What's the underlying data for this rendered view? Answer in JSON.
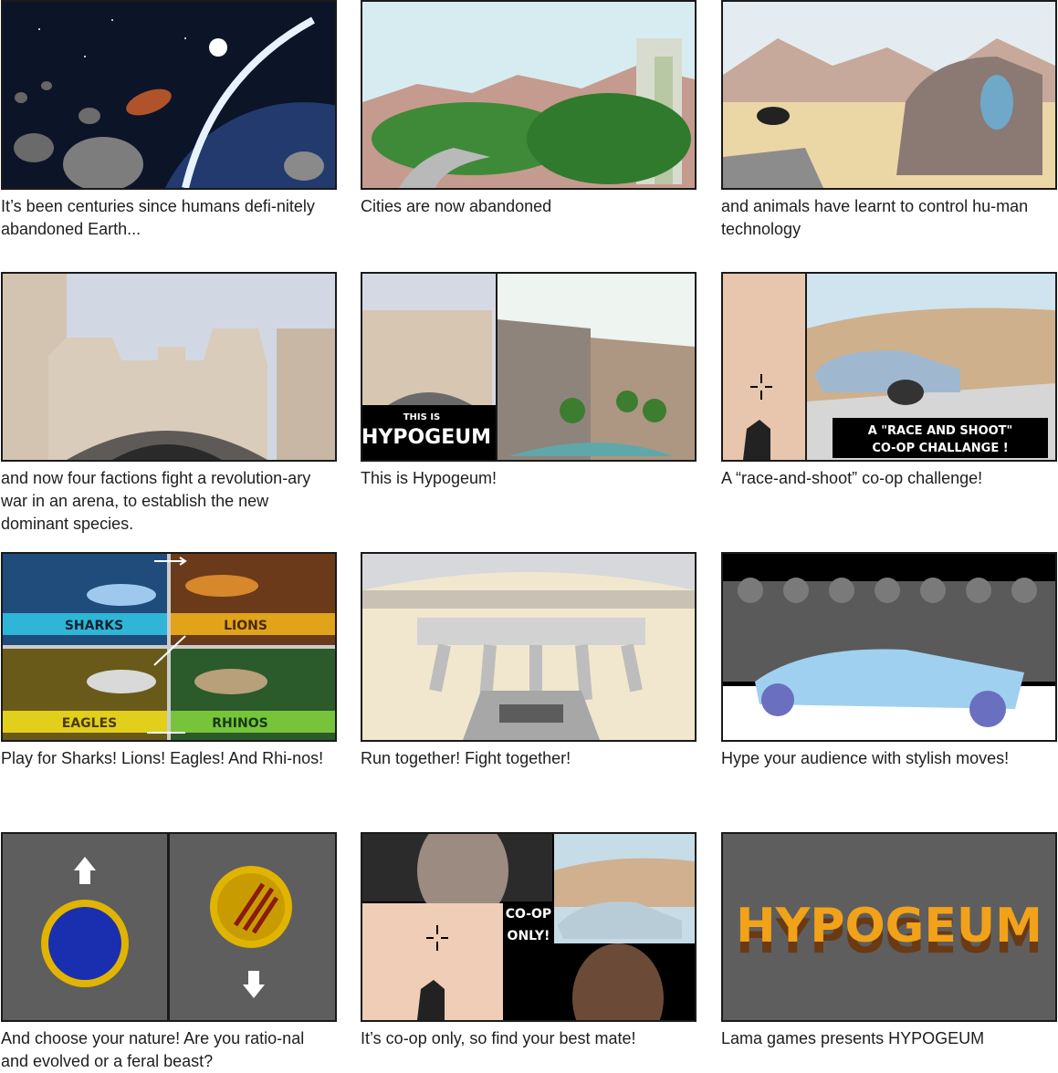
{
  "storyboard": {
    "panels": [
      {
        "caption": "It’s been centuries since humans defi-nitely abandoned Earth..."
      },
      {
        "caption": "Cities are now abandoned"
      },
      {
        "caption": "and animals have learnt to control hu-man technology"
      },
      {
        "caption": "and now four factions fight a revolution-ary war in an arena, to establish the new dominant species."
      },
      {
        "caption": "This is Hypogeum!",
        "art_text": "THIS IS\nHYPOGEUM"
      },
      {
        "caption": "A “race-and-shoot” co-op challenge!",
        "art_text": "A \"RACE AND SHOOT\"\nCO-OP CHALLANGE !"
      },
      {
        "caption": "Play for Sharks! Lions! Eagles! And Rhi-nos!",
        "factions": [
          "SHARKS",
          "LIONS",
          "EAGLES",
          "RHINOS"
        ]
      },
      {
        "caption": "Run together! Fight together!"
      },
      {
        "caption": "Hype your audience with stylish moves!"
      },
      {
        "caption": "And choose your nature! Are you ratio-nal and evolved or a feral beast?"
      },
      {
        "caption": "It’s co-op only, so find your best mate!",
        "art_text": "CO-OP\nONLY!"
      },
      {
        "caption": "Lama games presents HYPOGEUM",
        "logo_text": "HYPOGEUM"
      }
    ]
  }
}
